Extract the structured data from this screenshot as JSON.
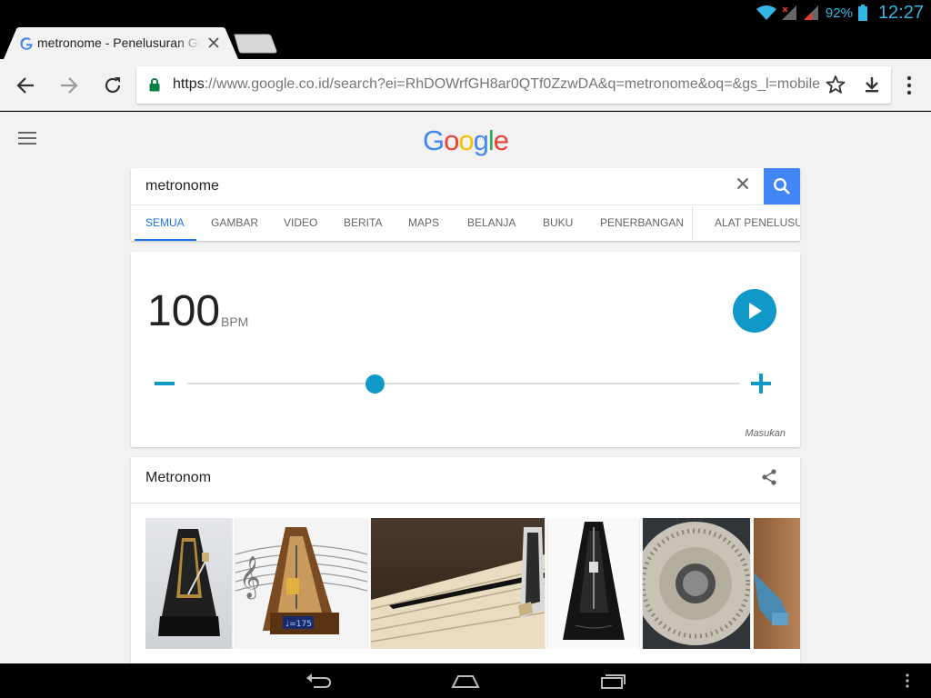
{
  "status": {
    "battery": "92%",
    "time": "12:27"
  },
  "tab": {
    "title": "metronome - Penelusuran Google"
  },
  "toolbar": {
    "url_scheme": "https",
    "url_rest": "://www.google.co.id/search?ei=RhDOWrfGH8ar0QTf0ZzwDA&q=metronome&oq=&gs_l=mobile-gws-wiz-serp"
  },
  "search": {
    "query": "metronome",
    "tabs": [
      "SEMUA",
      "GAMBAR",
      "VIDEO",
      "BERITA",
      "MAPS",
      "BELANJA",
      "BUKU",
      "PENERBANGAN",
      "ALAT PENELUSURAN"
    ],
    "active_tab": "SEMUA"
  },
  "metronome": {
    "bpm": "100",
    "unit": "BPM",
    "slider_fraction": 0.34,
    "feedback": "Masukan",
    "accent_color": "#1098c9"
  },
  "knowledge_panel": {
    "title": "Metronom",
    "images": [
      "metronome-black-photo",
      "metronome-music-notes-illustration",
      "piano-with-metronome",
      "black-metronome-photo",
      "metronome-dial-close-up",
      "blue-metronome-partial"
    ]
  },
  "colors": {
    "google_blue": "#4285f4",
    "google_red": "#ea4335",
    "google_yellow": "#fbbc05",
    "google_green": "#34a853"
  }
}
